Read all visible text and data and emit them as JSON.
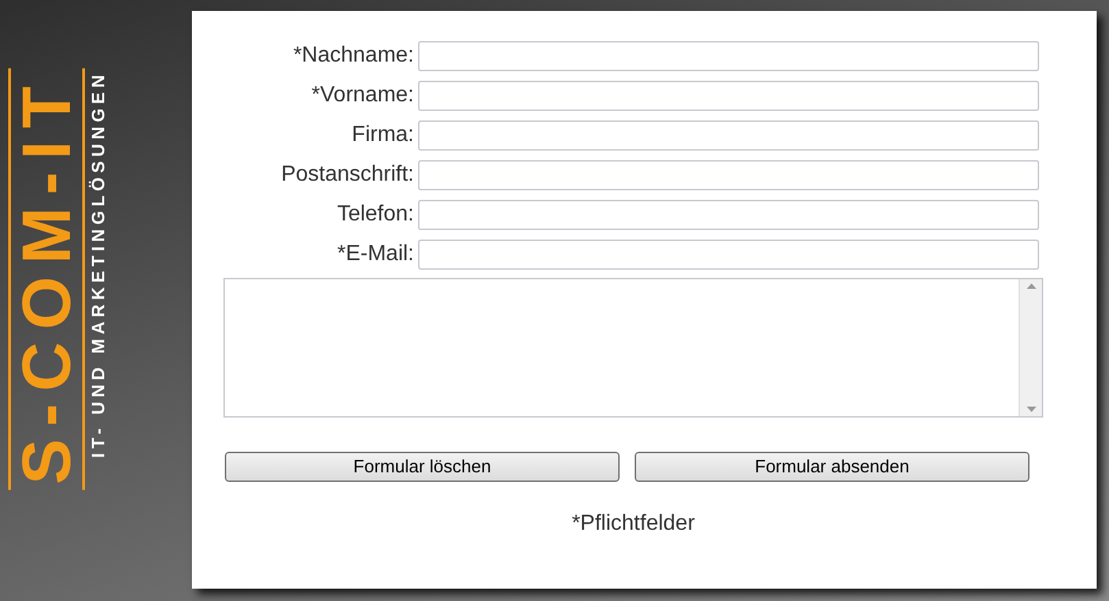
{
  "logo": {
    "name": "S-COM-IT",
    "tagline": "IT- UND MARKETINGLÖSUNGEN"
  },
  "form": {
    "fields": [
      {
        "label": "*Nachname:"
      },
      {
        "label": "*Vorname:"
      },
      {
        "label": "Firma:"
      },
      {
        "label": "Postanschrift:"
      },
      {
        "label": "Telefon:"
      },
      {
        "label": "*E-Mail:"
      }
    ],
    "buttons": [
      "Formular löschen",
      "Formular absenden"
    ],
    "note": "*Pflichtfelder"
  }
}
